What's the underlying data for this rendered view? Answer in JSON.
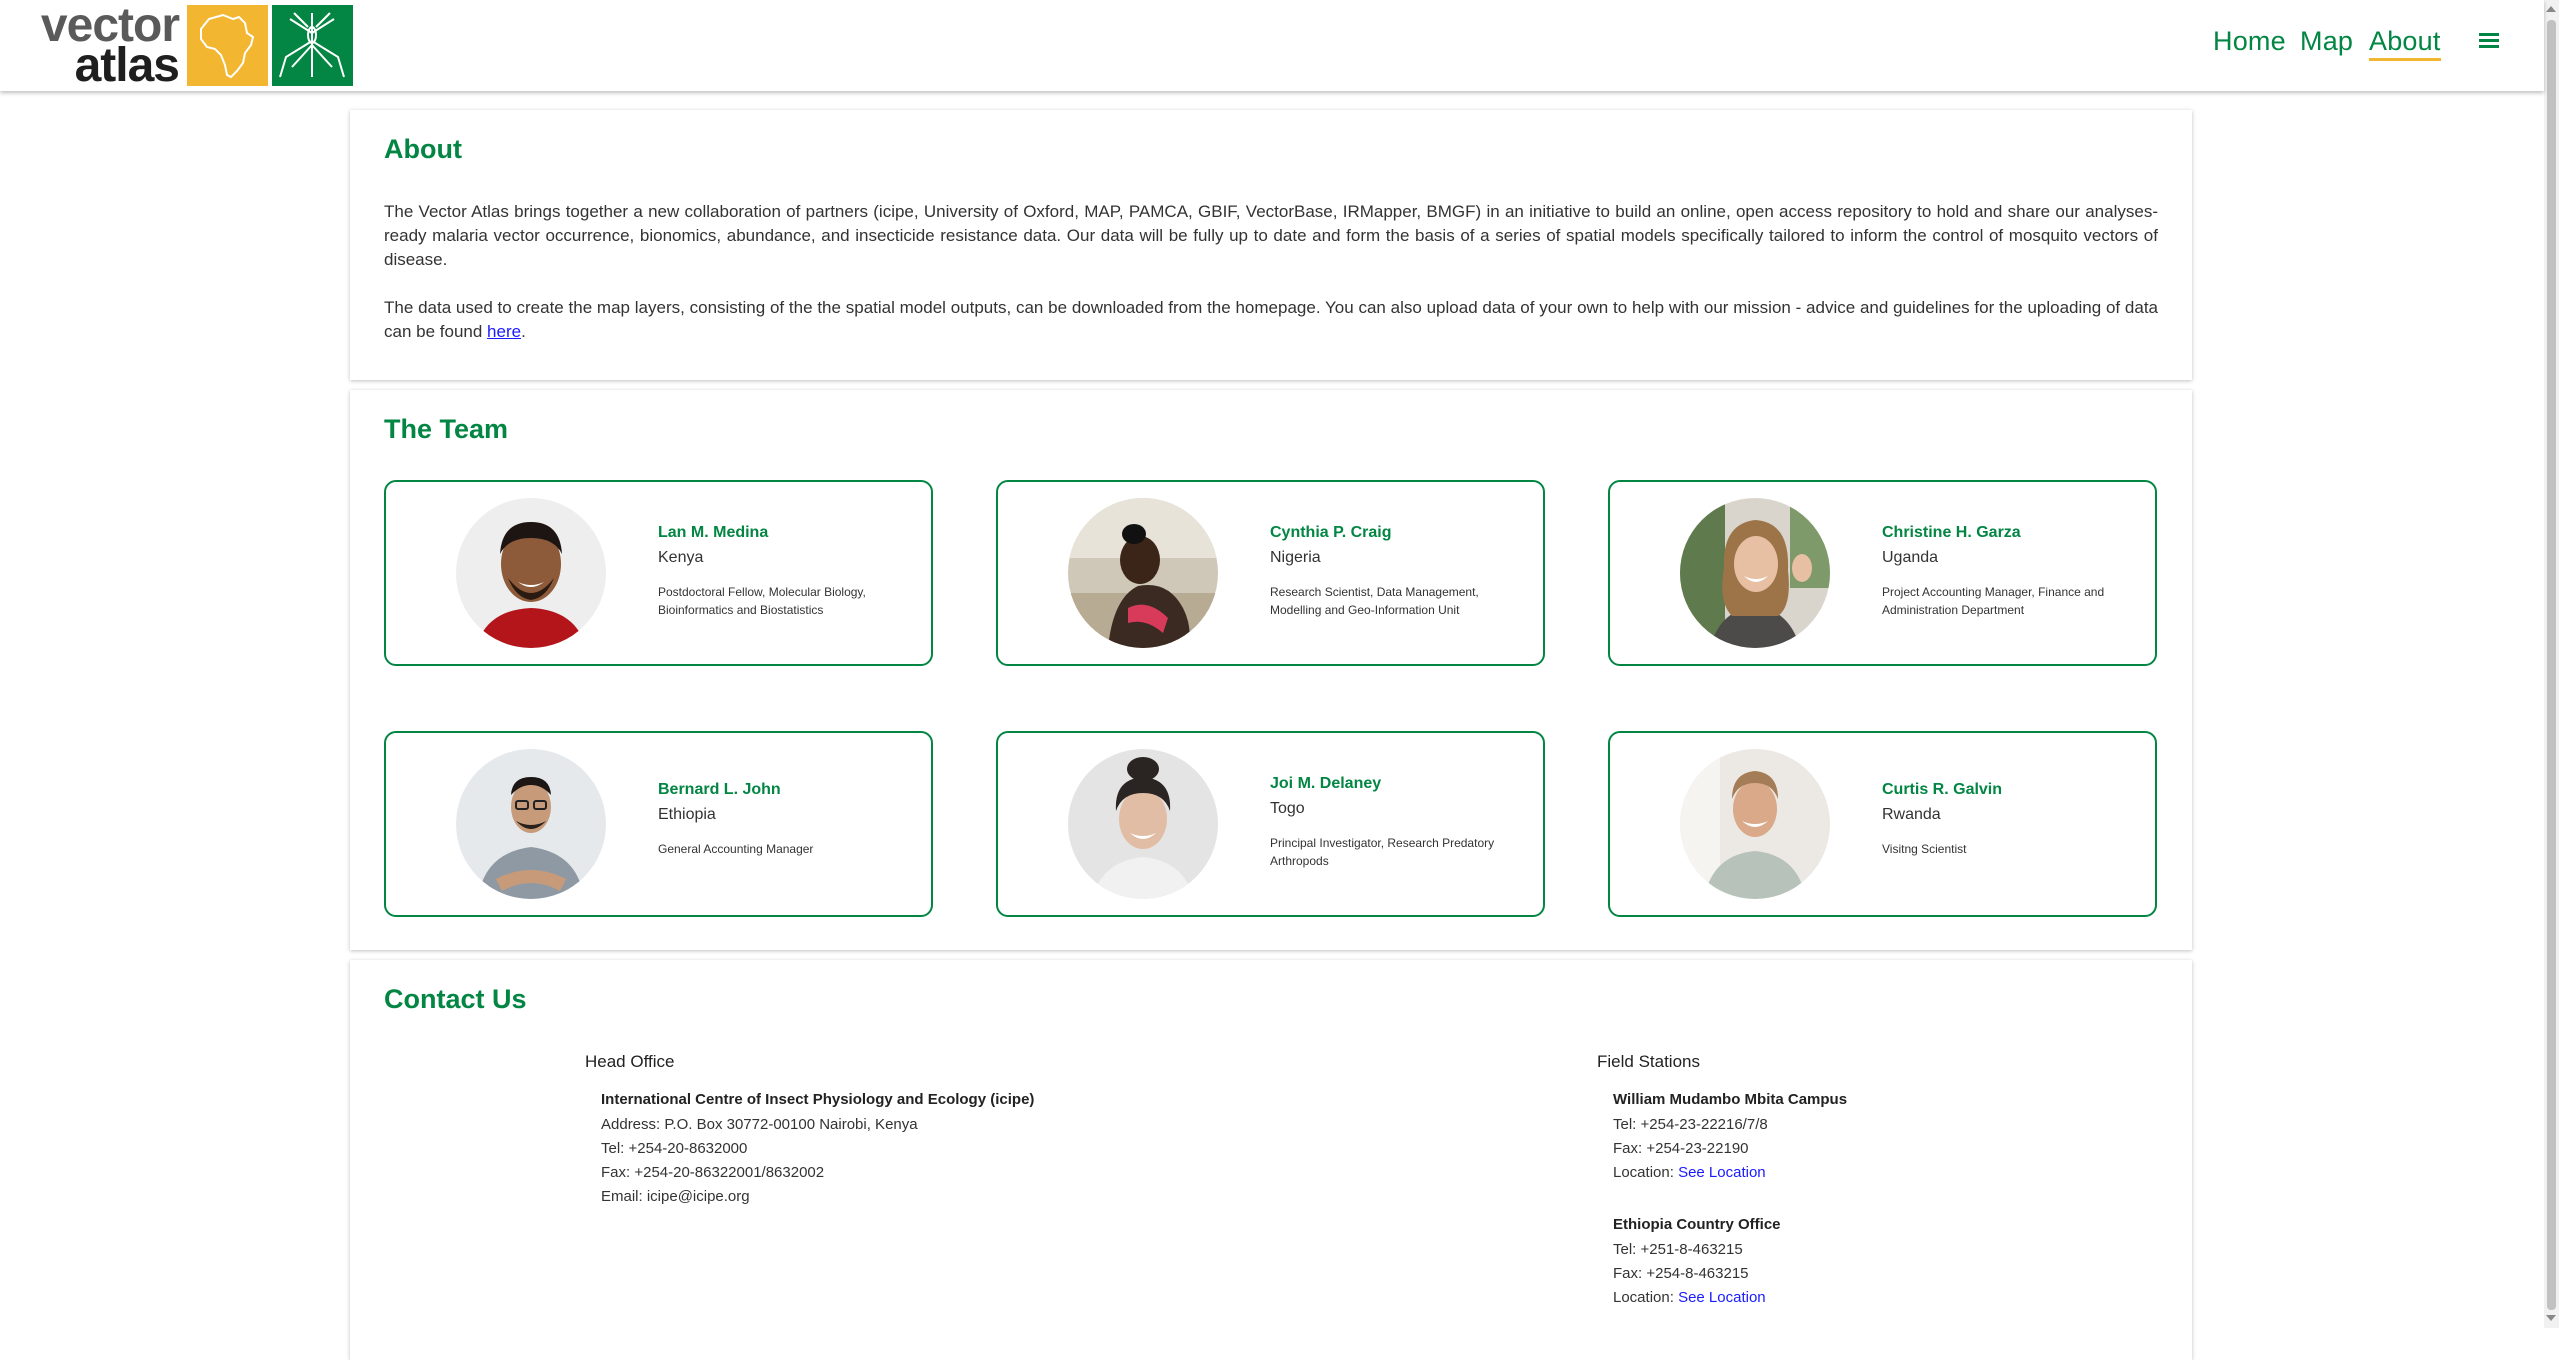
{
  "header": {
    "logo_line1": "vector",
    "logo_line2": "atlas",
    "nav": [
      "Home",
      "Map",
      "About"
    ],
    "active": "About"
  },
  "about": {
    "title": "About",
    "para1": "The Vector Atlas brings together a new collaboration of partners (icipe, University of Oxford, MAP, PAMCA, GBIF, VectorBase, IRMapper, BMGF) in an initiative to build an online, open access repository to hold and share our analyses-ready malaria vector occurrence, bionomics, abundance, and insecticide resistance data. Our data will be fully up to date and form the basis of a series of spatial models specifically tailored to inform the control of mosquito vectors of disease.",
    "para2_before": "The data used to create the map layers, consisting of the the spatial model outputs, can be downloaded from the homepage. You can also upload data of your own to help with our mission - advice and guidelines for the uploading of data can be found ",
    "para2_link": "here",
    "para2_after": "."
  },
  "team": {
    "title": "The Team",
    "members": [
      {
        "name": "Lan M. Medina",
        "country": "Kenya",
        "role": "Postdoctoral Fellow, Molecular Biology, Bioinformatics and Biostatistics"
      },
      {
        "name": "Cynthia P. Craig",
        "country": "Nigeria",
        "role": "Research Scientist, Data Management, Modelling and Geo-Information Unit"
      },
      {
        "name": "Christine H. Garza",
        "country": "Uganda",
        "role": "Project Accounting Manager, Finance and Administration Department"
      },
      {
        "name": "Bernard L. John",
        "country": "Ethiopia",
        "role": "General Accounting Manager"
      },
      {
        "name": "Joi M. Delaney",
        "country": "Togo",
        "role": "Principal Investigator, Research Predatory Arthropods"
      },
      {
        "name": "Curtis R. Galvin",
        "country": "Rwanda",
        "role": "Visitng Scientist"
      }
    ]
  },
  "contact": {
    "title": "Contact Us",
    "head_office": {
      "heading": "Head Office",
      "org": "International Centre of Insect Physiology and Ecology (icipe)",
      "address": "Address: P.O. Box 30772-00100 Nairobi, Kenya",
      "tel": "Tel: +254-20-8632000",
      "fax": "Fax: +254-20-86322001/8632002",
      "email": "Email: icipe@icipe.org"
    },
    "field_stations": {
      "heading": "Field Stations",
      "stations": [
        {
          "name": "William Mudambo Mbita Campus",
          "tel": "Tel: +254-23-22216/7/8",
          "fax": "Fax: +254-23-22190",
          "location_label": "Location:",
          "location_link": "See Location"
        },
        {
          "name": "Ethiopia Country Office",
          "tel": "Tel: +251-8-463215",
          "fax": "Fax: +254-8-463215",
          "location_label": "Location:",
          "location_link": "See Location"
        }
      ]
    }
  },
  "colors": {
    "brand_green": "#038543",
    "brand_yellow": "#f2b630",
    "link_blue": "#1a1aff"
  }
}
